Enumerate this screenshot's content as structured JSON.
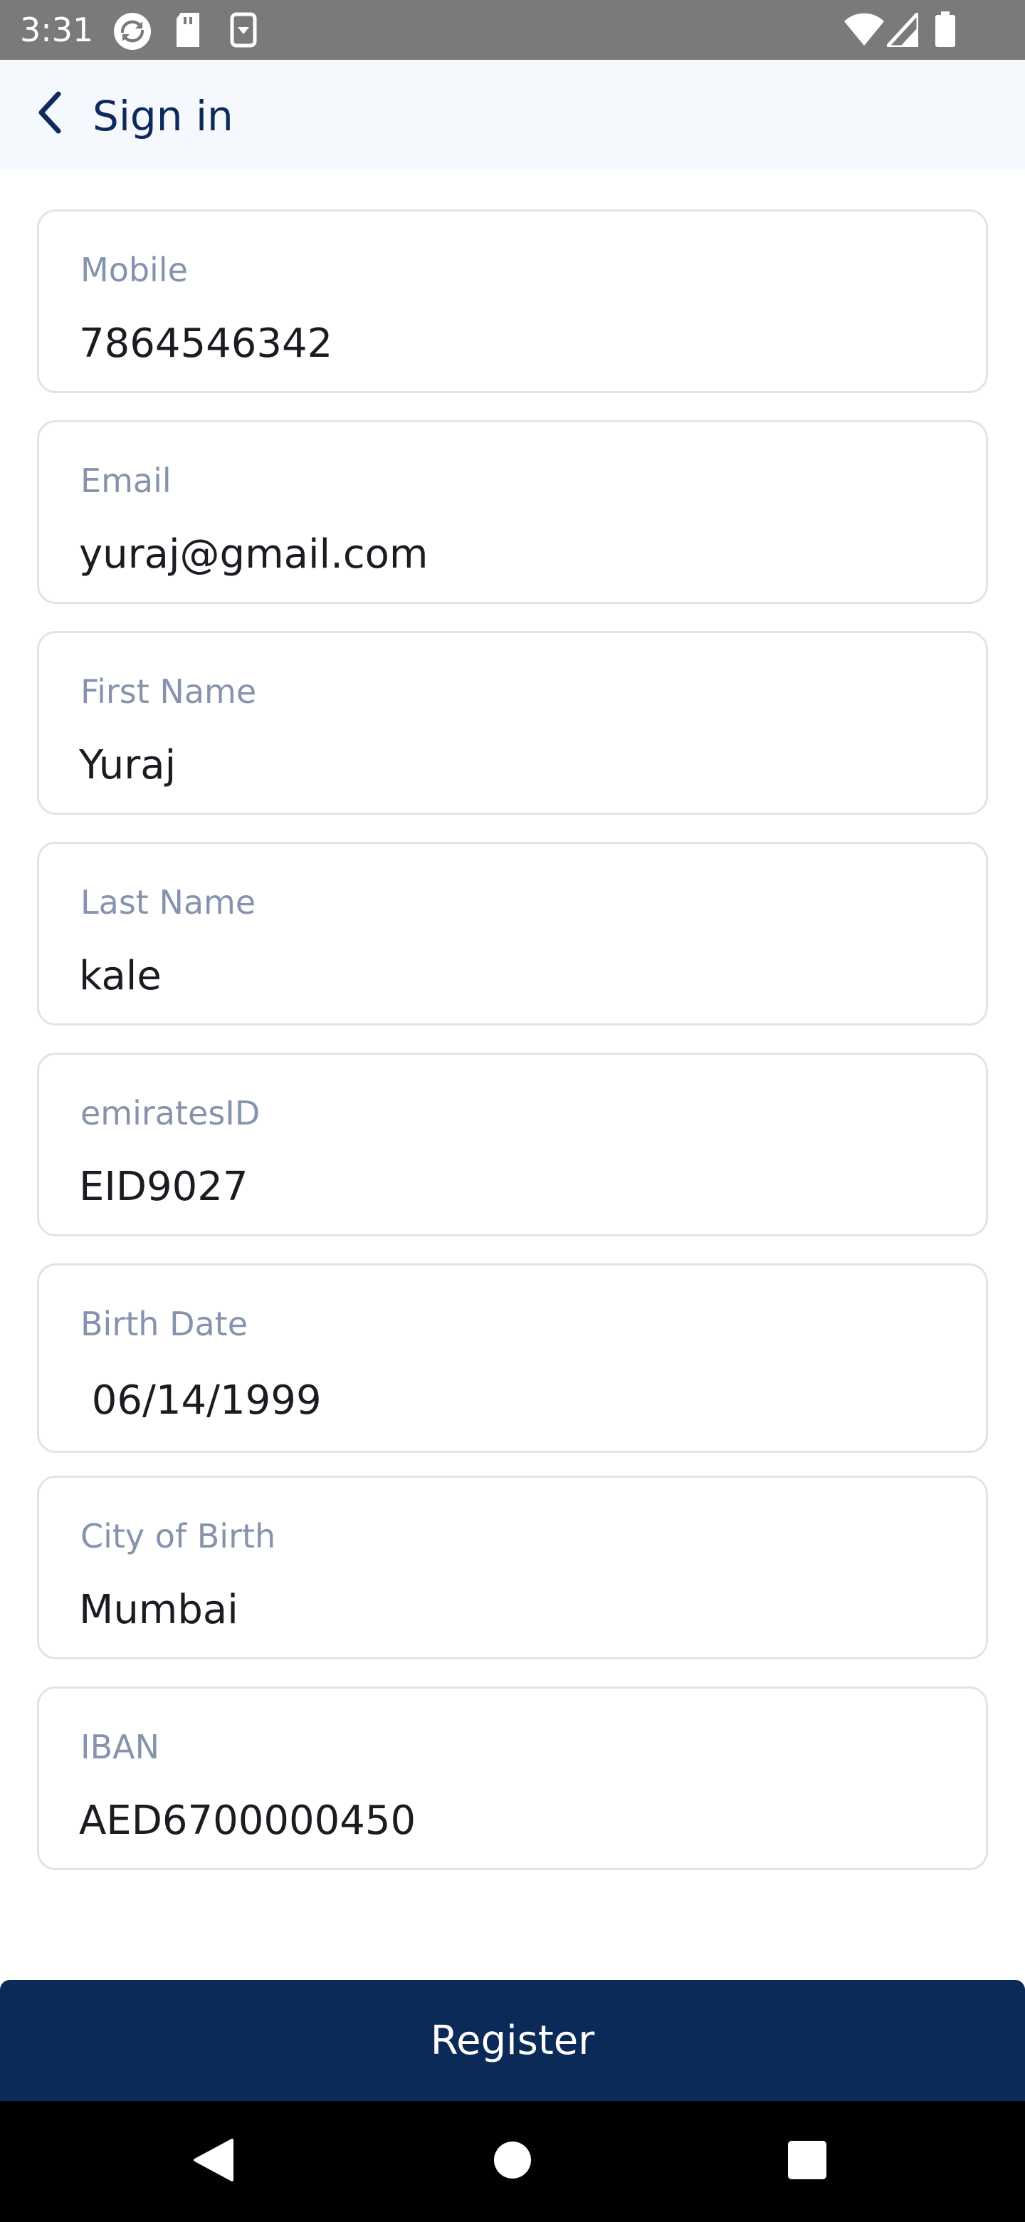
{
  "status_bar": {
    "time": "3:31",
    "left_icons": [
      "sync-icon",
      "sd-card-icon",
      "download-icon"
    ],
    "right_icons": [
      "wifi-icon",
      "signal-icon",
      "battery-icon"
    ]
  },
  "app_bar": {
    "title": "Sign in",
    "back_icon": "chevron-left-icon"
  },
  "form": {
    "fields": [
      {
        "label": "Mobile",
        "value": "7864546342"
      },
      {
        "label": "Email",
        "value": "yuraj@gmail.com"
      },
      {
        "label": "First Name",
        "value": "Yuraj"
      },
      {
        "label": "Last Name",
        "value": "kale"
      },
      {
        "label": "emiratesID",
        "value": "EID9027"
      },
      {
        "label": "Birth Date",
        "value": " 06/14/1999"
      },
      {
        "label": "City of Birth",
        "value": "Mumbai"
      },
      {
        "label": "IBAN",
        "value": "AED6700000450"
      }
    ]
  },
  "register_button": {
    "label": "Register"
  },
  "nav_bar": {
    "icons": [
      "back-triangle-icon",
      "home-circle-icon",
      "recents-square-icon"
    ]
  },
  "colors": {
    "primary": "#0b2a58",
    "app_bar_bg": "#f5f8fd",
    "label": "#8593ad",
    "border": "#dfe3ea",
    "status_bar_bg": "#7a7a7a"
  }
}
